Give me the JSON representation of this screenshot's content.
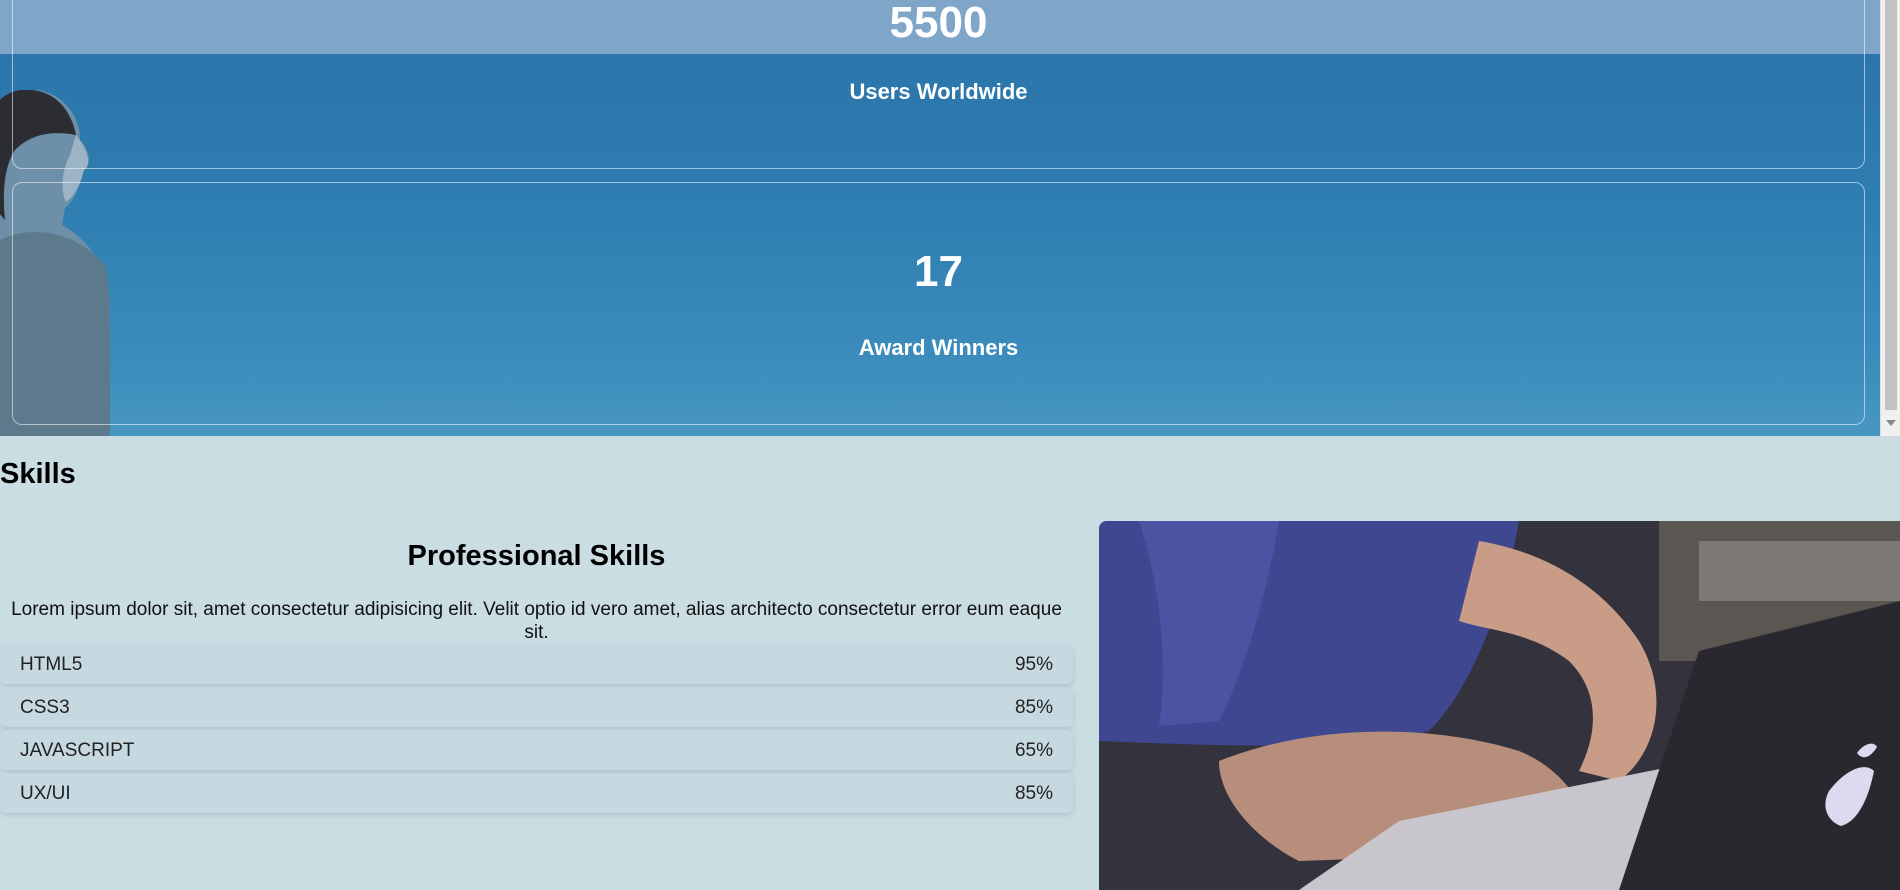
{
  "stats": [
    {
      "number": "5500",
      "label": "Users Worldwide"
    },
    {
      "number": "17",
      "label": "Award Winners"
    }
  ],
  "skills": {
    "heading": "Skills",
    "subtitle": "Professional Skills",
    "description": "Lorem ipsum dolor sit, amet consectetur adipisicing elit. Velit optio id vero amet, alias architecto consectetur error eum eaque sit.",
    "items": [
      {
        "name": "HTML5",
        "percent": "95%",
        "level": 0.95
      },
      {
        "name": "CSS3",
        "percent": "85%",
        "level": 0.85
      },
      {
        "name": "JAVASCRIPT",
        "percent": "65%",
        "level": 0.65
      },
      {
        "name": "UX/UI",
        "percent": "85%",
        "level": 0.85
      }
    ]
  },
  "colors": {
    "stats_background": "#2e7db1",
    "skills_background": "#c9dde3",
    "skill_row": "#c6d9e0"
  }
}
